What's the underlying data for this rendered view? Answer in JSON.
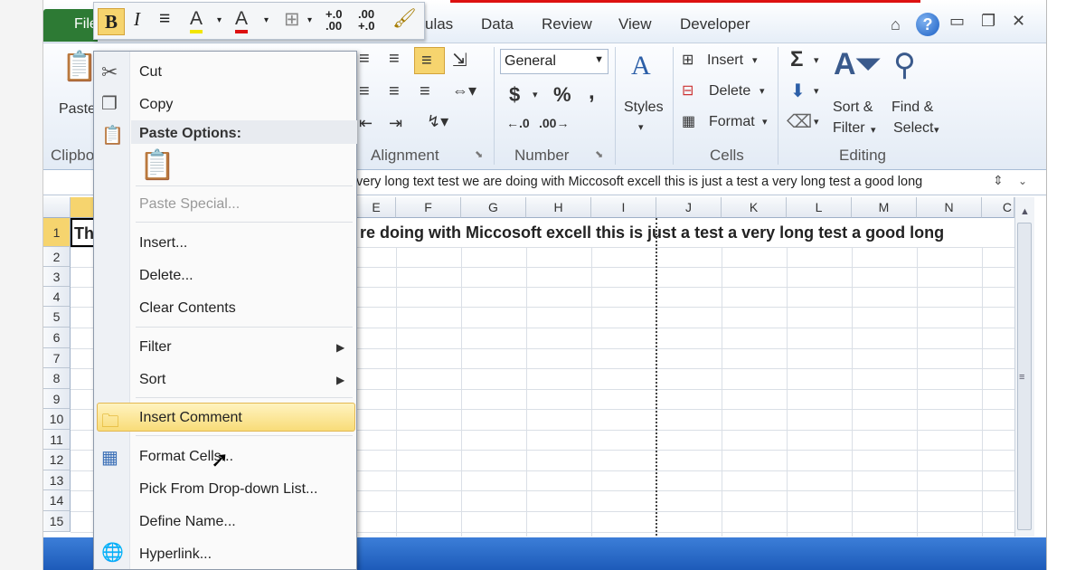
{
  "tabs": {
    "file": "File",
    "formulas": "ulas",
    "data": "Data",
    "review": "Review",
    "view": "View",
    "developer": "Developer"
  },
  "mini_toolbar": {
    "bold": "B",
    "italic": "I",
    "align": "≡",
    "fill": "A",
    "font_color": "A",
    "increase_decimal": "+.0\n.00",
    "decrease_decimal": ".00\n+.0"
  },
  "ribbon": {
    "paste": "Paste",
    "clipboard": "Clipbo",
    "alignment": "Alignment",
    "number_format": "General",
    "currency": "$",
    "percent": "%",
    "comma": ",",
    "number": "Number",
    "styles": "Styles",
    "insert": "Insert",
    "delete": "Delete",
    "format": "Format",
    "cells": "Cells",
    "sum": "Σ",
    "sort_filter_1": "Sort &",
    "sort_filter_2": "Filter",
    "find_select_1": "Find &",
    "find_select_2": "Select",
    "editing": "Editing"
  },
  "formula_bar": {
    "text": "very long text test we are doing with Miccosoft excell this is just a test a very long test a good long"
  },
  "columns": [
    "E",
    "F",
    "G",
    "H",
    "I",
    "J",
    "K",
    "L",
    "M",
    "N",
    "C"
  ],
  "rows": [
    "1",
    "2",
    "3",
    "4",
    "5",
    "6",
    "7",
    "8",
    "9",
    "10",
    "11",
    "12",
    "13",
    "14",
    "15"
  ],
  "cell_a1_partial": "Th",
  "cell_text_visible": "re doing with Miccosoft excell this is just a test a very long test a good long",
  "context_menu": {
    "cut": "Cut",
    "copy": "Copy",
    "paste_options": "Paste Options:",
    "paste_special": "Paste Special...",
    "insert": "Insert...",
    "delete": "Delete...",
    "clear_contents": "Clear Contents",
    "filter": "Filter",
    "sort": "Sort",
    "insert_comment": "Insert Comment",
    "format_cells": "Format Cells...",
    "pick_from_list": "Pick From Drop-down List...",
    "define_name": "Define Name...",
    "hyperlink": "Hyperlink..."
  },
  "colors": {
    "file_tab": "#2d7a34",
    "highlight": "#f6d46e",
    "ribbon_bg": "#e3ebf5",
    "taskbar": "#1d5bb9"
  }
}
